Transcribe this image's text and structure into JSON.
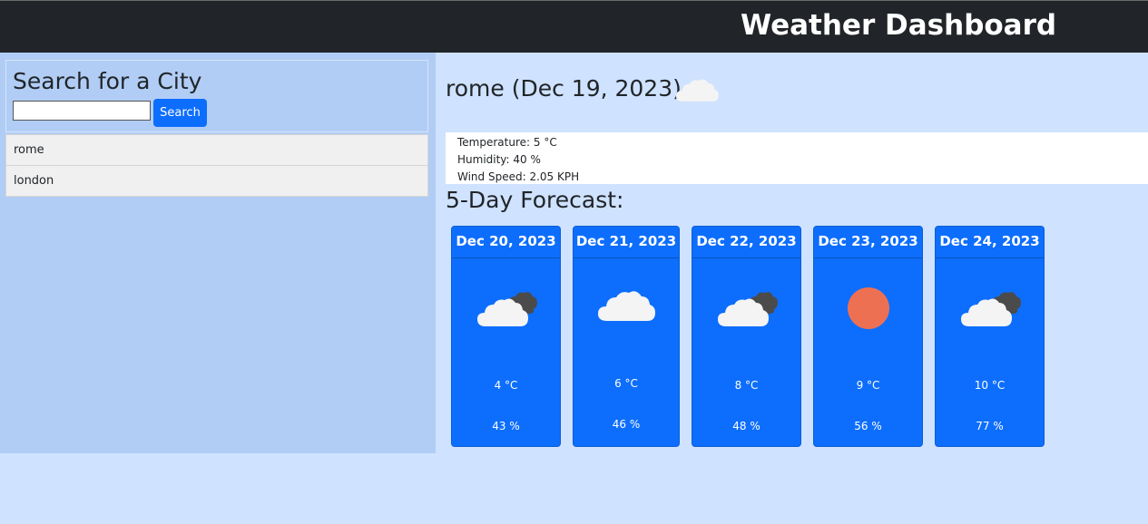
{
  "header": {
    "title": "Weather Dashboard"
  },
  "sidebar": {
    "heading": "Search for a City",
    "search": {
      "value": "",
      "placeholder": "",
      "button_label": "Search"
    },
    "history": [
      {
        "label": "rome"
      },
      {
        "label": "london"
      }
    ]
  },
  "current": {
    "title": "rome (Dec 19, 2023)",
    "icon": "cloud-icon",
    "temperature": "Temperature: 5 °C",
    "humidity": "Humidity: 40 %",
    "wind": "Wind Speed: 2.05 KPH"
  },
  "forecast": {
    "heading": "5-Day Forecast:",
    "days": [
      {
        "date": "Dec 20, 2023",
        "icon": "broken-clouds-icon",
        "temp": "4 °C",
        "humidity": "43 %"
      },
      {
        "date": "Dec 21, 2023",
        "icon": "cloud-icon",
        "temp": "6 °C",
        "humidity": "46 %"
      },
      {
        "date": "Dec 22, 2023",
        "icon": "broken-clouds-icon",
        "temp": "8 °C",
        "humidity": "48 %"
      },
      {
        "date": "Dec 23, 2023",
        "icon": "sun-icon",
        "temp": "9 °C",
        "humidity": "56 %"
      },
      {
        "date": "Dec 24, 2023",
        "icon": "broken-clouds-icon",
        "temp": "10 °C",
        "humidity": "77 %"
      }
    ]
  },
  "colors": {
    "navbar": "#212529",
    "page_background": "#cfe2ff",
    "sidebar_background": "#b1cdf5",
    "accent": "#0d6efd",
    "sun": "#ee7052"
  }
}
